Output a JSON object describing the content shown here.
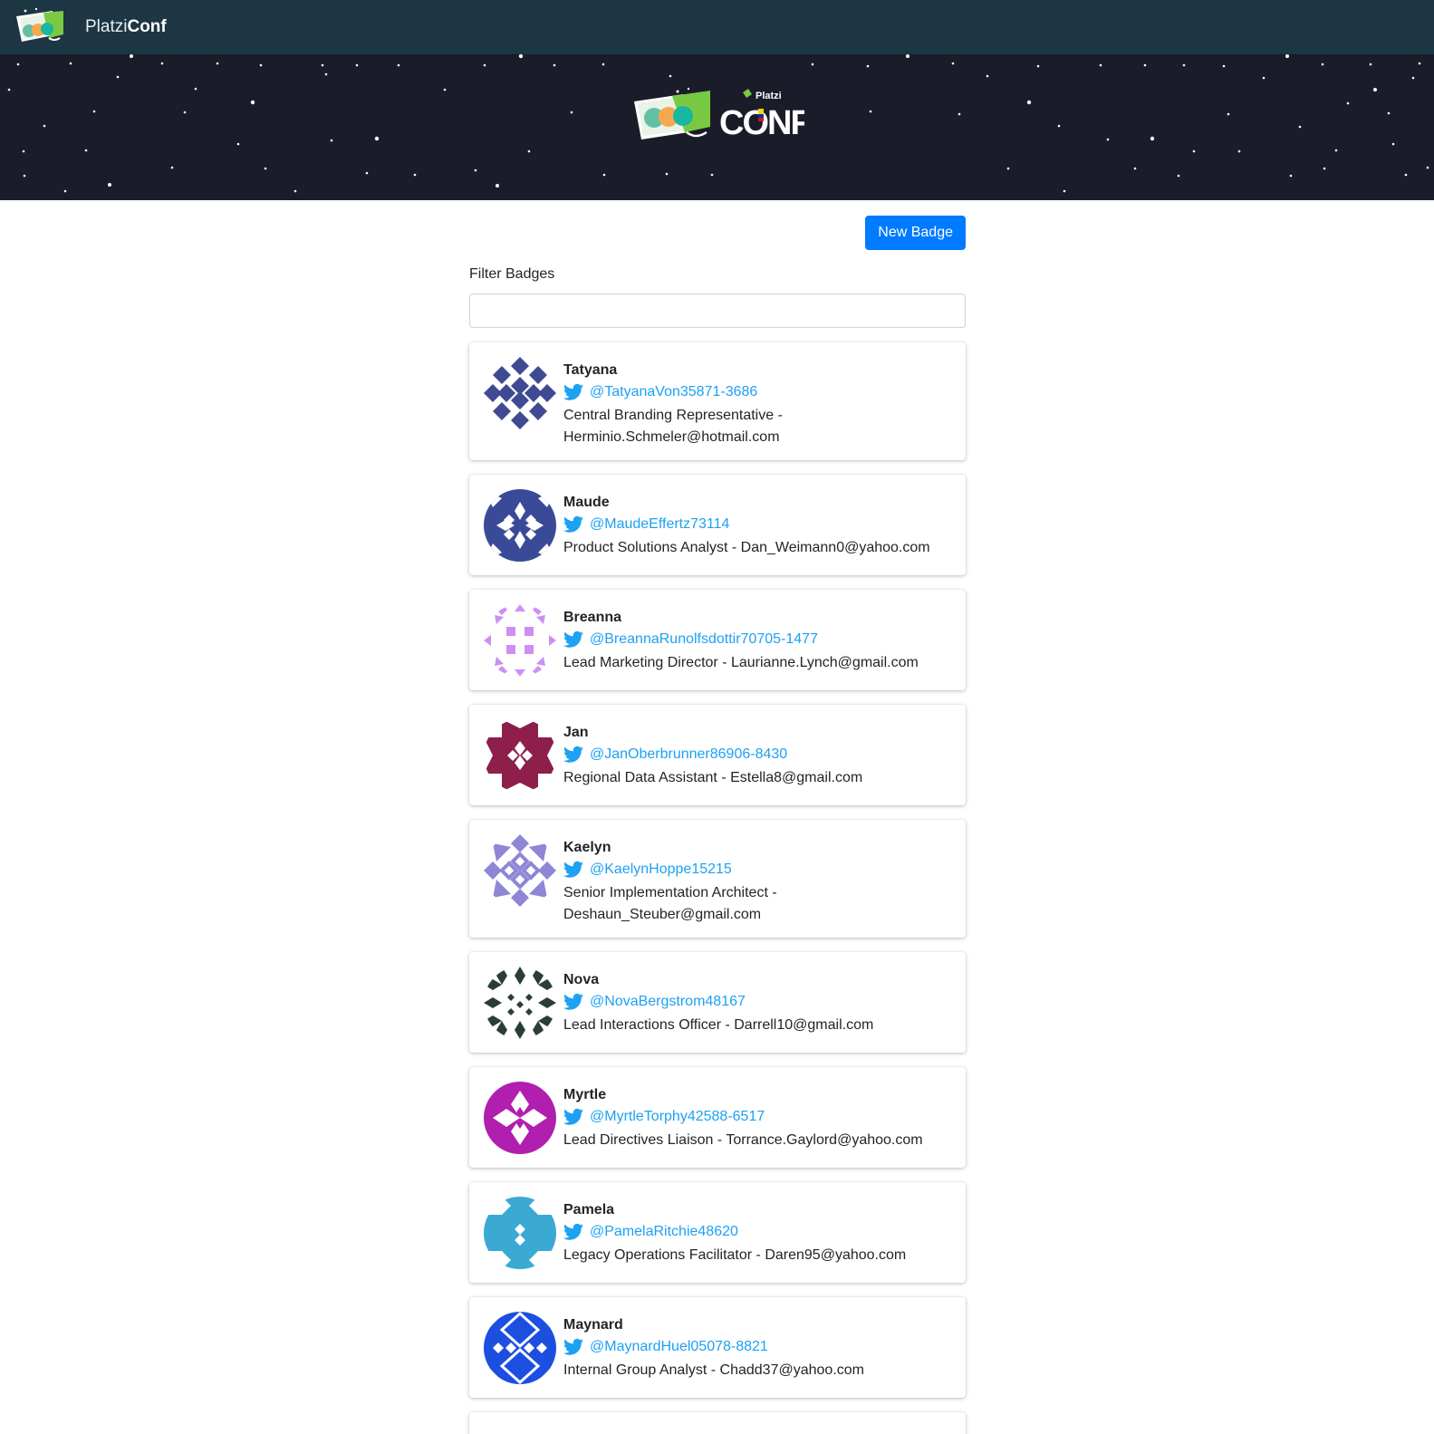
{
  "navbar": {
    "brand_light": "Platzi",
    "brand_bold": "Conf",
    "logo_icon": "platziconf-logo-icon"
  },
  "hero": {
    "logo_small_text": "Platzi",
    "logo_main_text": "CONF"
  },
  "actions": {
    "new_badge_label": "New Badge"
  },
  "filter": {
    "label": "Filter Badges",
    "value": "",
    "placeholder": ""
  },
  "badges": [
    {
      "first_name": "Tatyana",
      "twitter": "@TatyanaVon35871-3686",
      "meta_line1": "Central Branding Representative -",
      "meta_line2": "Herminio.Schmeler@hotmail.com",
      "avatar_color": "#3f4a93",
      "avatar_icon": "identicon-avatar"
    },
    {
      "first_name": "Maude",
      "twitter": "@MaudeEffertz73114",
      "meta_line1": "Product Solutions Analyst - Dan_Weimann0@yahoo.com",
      "meta_line2": "",
      "avatar_color": "#3b4a97",
      "avatar_icon": "identicon-avatar"
    },
    {
      "first_name": "Breanna",
      "twitter": "@BreannaRunolfsdottir70705-1477",
      "meta_line1": "Lead Marketing Director - Laurianne.Lynch@gmail.com",
      "meta_line2": "",
      "avatar_color": "#cf8ef5",
      "avatar_icon": "identicon-avatar"
    },
    {
      "first_name": "Jan",
      "twitter": "@JanOberbrunner86906-8430",
      "meta_line1": "Regional Data Assistant - Estella8@gmail.com",
      "meta_line2": "",
      "avatar_color": "#8e1f4a",
      "avatar_icon": "identicon-avatar"
    },
    {
      "first_name": "Kaelyn",
      "twitter": "@KaelynHoppe15215",
      "meta_line1": "Senior Implementation Architect -",
      "meta_line2": "Deshaun_Steuber@gmail.com",
      "avatar_color": "#8f86d6",
      "avatar_icon": "identicon-avatar"
    },
    {
      "first_name": "Nova",
      "twitter": "@NovaBergstrom48167",
      "meta_line1": "Lead Interactions Officer - Darrell10@gmail.com",
      "meta_line2": "",
      "avatar_color": "#2c3d36",
      "avatar_icon": "identicon-avatar"
    },
    {
      "first_name": "Myrtle",
      "twitter": "@MyrtleTorphy42588-6517",
      "meta_line1": "Lead Directives Liaison - Torrance.Gaylord@yahoo.com",
      "meta_line2": "",
      "avatar_color": "#b01fae",
      "avatar_icon": "identicon-avatar"
    },
    {
      "first_name": "Pamela",
      "twitter": "@PamelaRitchie48620",
      "meta_line1": "Legacy Operations Facilitator - Daren95@yahoo.com",
      "meta_line2": "",
      "avatar_color": "#3aa9d4",
      "avatar_icon": "identicon-avatar"
    },
    {
      "first_name": "Maynard",
      "twitter": "@MaynardHuel05078-8821",
      "meta_line1": "Internal Group Analyst - Chadd37@yahoo.com",
      "meta_line2": "",
      "avatar_color": "#1c4fe0",
      "avatar_icon": "identicon-avatar"
    }
  ]
}
